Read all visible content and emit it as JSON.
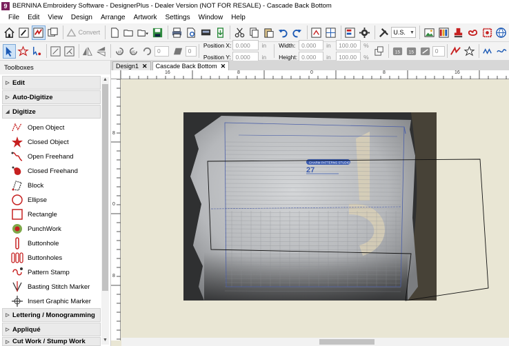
{
  "window": {
    "app_icon_letter": "9",
    "title": "BERNINA Embroidery Software - DesignerPlus - Dealer Version (NOT FOR RESALE) - Cascade Back Bottom"
  },
  "menu": [
    "File",
    "Edit",
    "View",
    "Design",
    "Arrange",
    "Artwork",
    "Settings",
    "Window",
    "Help"
  ],
  "toolbar1": {
    "convert_label": "Convert",
    "language_select": "U.S."
  },
  "toolbar2": {
    "rotate_value": "0",
    "skew_value": "0",
    "position_x_label": "Position X:",
    "position_y_label": "Position Y:",
    "position_x": "0.000",
    "position_y": "0.000",
    "width_label": "Width:",
    "height_label": "Height:",
    "width": "0.000",
    "height": "0.000",
    "unit": "in",
    "scale_w": "100.00",
    "scale_h": "100.00",
    "percent": "%",
    "stitch_angle_value": "0"
  },
  "toolbox": {
    "header": "Toolboxes",
    "sections": [
      {
        "label": "Edit",
        "expanded": false
      },
      {
        "label": "Auto-Digitize",
        "expanded": false
      },
      {
        "label": "Digitize",
        "expanded": true
      },
      {
        "label": "Lettering / Monogramming",
        "expanded": false
      },
      {
        "label": "Appliqué",
        "expanded": false
      },
      {
        "label": "Cut Work / Stump Work",
        "expanded": false
      }
    ],
    "tools": [
      "Open Object",
      "Closed Object",
      "Open Freehand",
      "Closed Freehand",
      "Block",
      "Ellipse",
      "Rectangle",
      "PunchWork",
      "Buttonhole",
      "Buttonholes",
      "Pattern Stamp",
      "Basting Stitch Marker",
      "Insert Graphic Marker"
    ]
  },
  "tabs": [
    {
      "label": "Design1",
      "active": false
    },
    {
      "label": "Cascade Back Bottom",
      "active": true
    }
  ],
  "rulers": {
    "h_labels": [
      "16",
      "8",
      "0",
      "8",
      "16"
    ],
    "v_labels": [
      "8",
      "0",
      "8"
    ]
  },
  "canvas": {
    "logo_brand_text": "CHARM PATTERNS STUDIO",
    "size_number": "27",
    "big_numeral": "15"
  },
  "colors": {
    "canvas_bg": "#e9e6d4",
    "accent_blue": "#2f68c8",
    "toolbar_bg": "#f3f3f3"
  }
}
